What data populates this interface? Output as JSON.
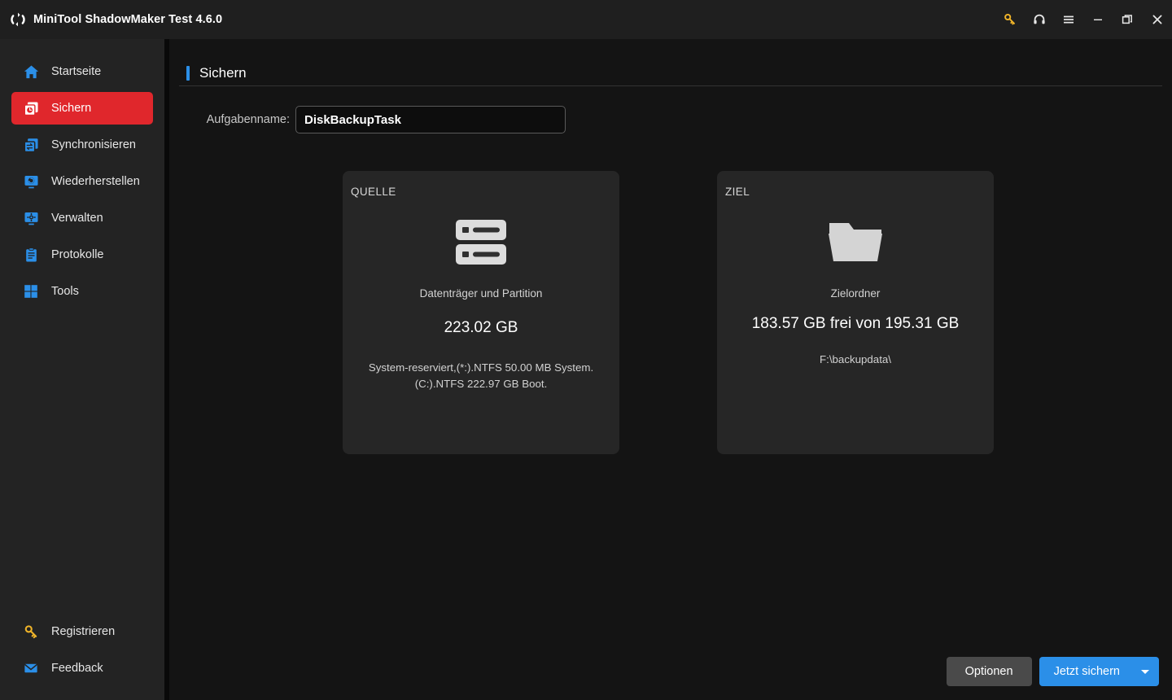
{
  "window": {
    "title": "MiniTool ShadowMaker Test 4.6.0",
    "logo_icon": "sync-circle-logo",
    "controls": [
      {
        "name": "license-key-button",
        "icon": "key-icon",
        "label": ""
      },
      {
        "name": "support-button",
        "icon": "headset-icon",
        "label": ""
      },
      {
        "name": "menu-button",
        "icon": "hamburger-menu-icon",
        "label": ""
      },
      {
        "name": "minimize-button",
        "icon": "minimize-icon",
        "label": ""
      },
      {
        "name": "maximize-button",
        "icon": "maximize-restore-icon",
        "label": ""
      },
      {
        "name": "close-button",
        "icon": "close-icon",
        "label": ""
      }
    ]
  },
  "sidebar": {
    "items": [
      {
        "label": "Startseite",
        "icon": "home-icon",
        "active": false
      },
      {
        "label": "Sichern",
        "icon": "backup-icon",
        "active": true
      },
      {
        "label": "Synchronisieren",
        "icon": "sync-icon",
        "active": false
      },
      {
        "label": "Wiederherstellen",
        "icon": "restore-icon",
        "active": false
      },
      {
        "label": "Verwalten",
        "icon": "manage-icon",
        "active": false
      },
      {
        "label": "Protokolle",
        "icon": "logs-icon",
        "active": false
      },
      {
        "label": "Tools",
        "icon": "tools-grid-icon",
        "active": false
      }
    ],
    "bottom_items": [
      {
        "label": "Registrieren",
        "icon": "key-icon"
      },
      {
        "label": "Feedback",
        "icon": "envelope-icon"
      }
    ],
    "active_color": "#e0272c",
    "icon_color": "#2b8fe8"
  },
  "page": {
    "title": "Sichern",
    "accent_color": "#2b8fe8",
    "task_name_label": "Aufgabenname:",
    "task_name_value": "DiskBackupTask",
    "task_name_placeholder": "Aufgabenname"
  },
  "source_card": {
    "tag": "QUELLE",
    "icon": "disk-stack-icon",
    "subtitle": "Datenträger und Partition",
    "size": "223.02 GB",
    "detail": "System-reserviert,(*:).NTFS 50.00 MB System. (C:).NTFS 222.97 GB Boot."
  },
  "transfer_arrow": {
    "icon": "triple-chevron-right-icon"
  },
  "target_card": {
    "tag": "ZIEL",
    "icon": "folder-icon",
    "subtitle": "Zielordner",
    "size": "183.57 GB frei von 195.31 GB",
    "detail": "F:\\backupdata\\"
  },
  "footer": {
    "options_label": "Optionen",
    "backup_now_label": "Jetzt sichern",
    "dropdown_icon": "caret-down-icon",
    "primary_color": "#2b8fe8"
  }
}
